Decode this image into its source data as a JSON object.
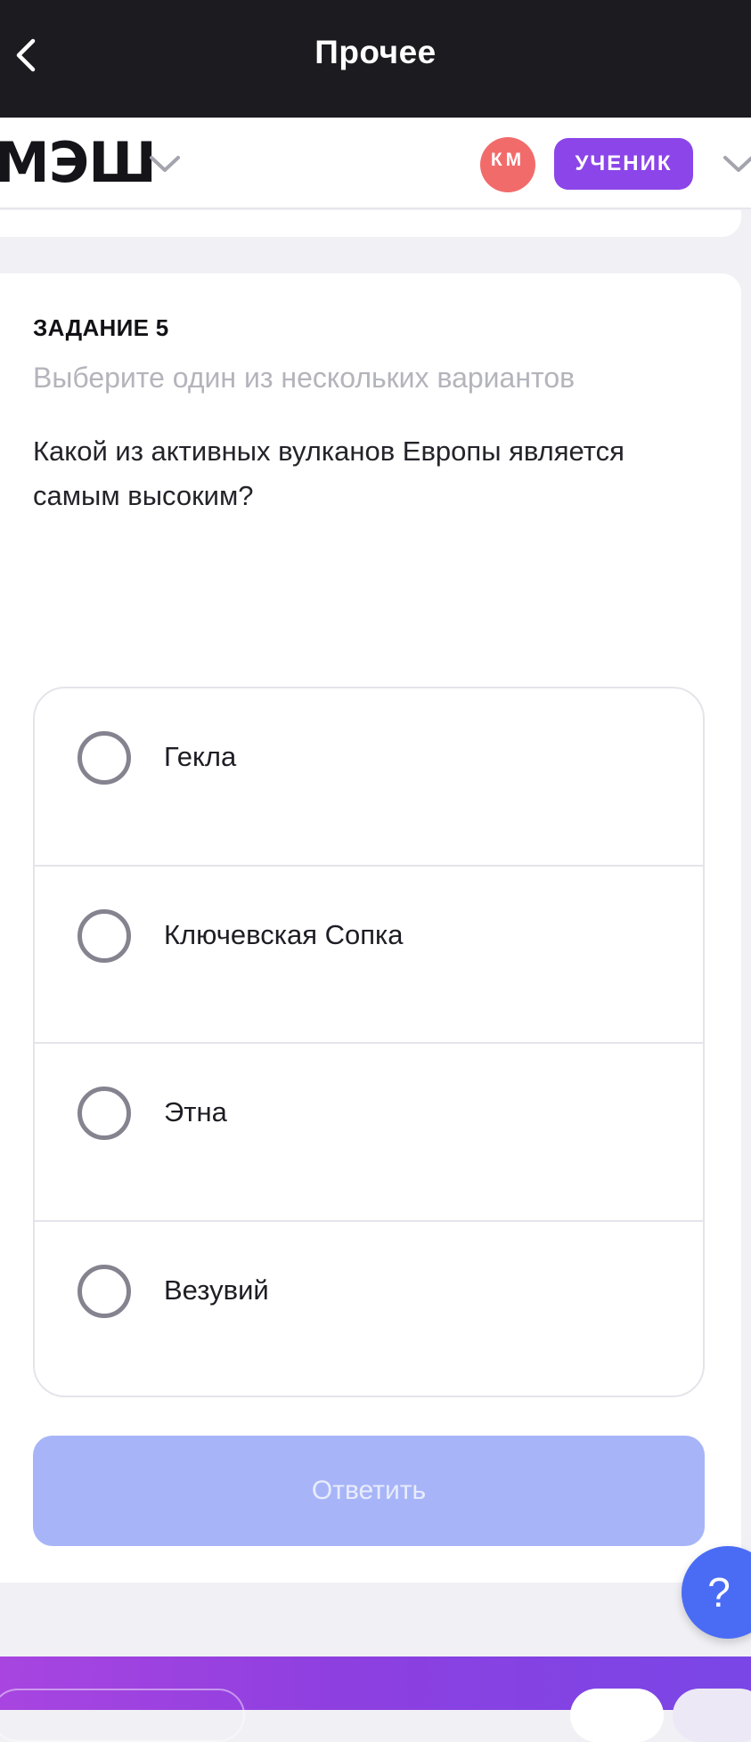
{
  "topbar": {
    "title": "Прочее",
    "back_icon": "chevron-left-icon"
  },
  "header": {
    "logo_text": "МЭШ",
    "logo_chevron_icon": "chevron-down-icon",
    "avatar_initials": "КМ",
    "role_label": "УЧЕНИК",
    "menu_chevron_icon": "chevron-down-icon"
  },
  "task": {
    "label": "ЗАДАНИЕ 5",
    "hint": "Выберите один из нескольких вариантов",
    "question": "Какой из активных вулканов Европы является самым высоким?",
    "options": [
      {
        "label": "Гекла"
      },
      {
        "label": "Ключевская Сопка"
      },
      {
        "label": "Этна"
      },
      {
        "label": "Везувий"
      }
    ],
    "answer_button": "Ответить"
  },
  "help_button": "?",
  "colors": {
    "topbar": "#1c1b20",
    "role_badge": "#8b45e8",
    "avatar": "#f26b6b",
    "answer_button_disabled": "#a7b5f8",
    "help_button": "#4a6cf5"
  }
}
